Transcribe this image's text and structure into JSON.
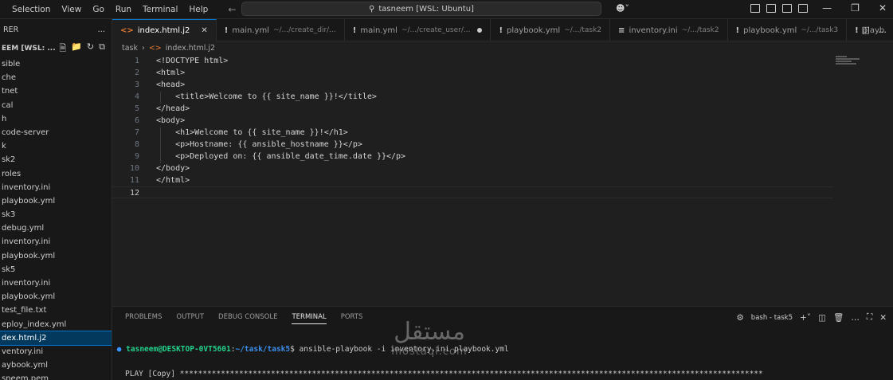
{
  "menu": [
    "Selection",
    "View",
    "Go",
    "Run",
    "Terminal",
    "Help"
  ],
  "search": {
    "label": "tasneem [WSL: Ubuntu]"
  },
  "sidebar": {
    "header": "RER",
    "folder": "EEM [WSL: ...",
    "items": [
      {
        "label": "sible",
        "selected": false
      },
      {
        "label": "che",
        "selected": false
      },
      {
        "label": "tnet",
        "selected": false
      },
      {
        "label": "cal",
        "selected": false
      },
      {
        "label": "h",
        "selected": false
      },
      {
        "label": "code-server",
        "selected": false
      },
      {
        "label": "k",
        "selected": false
      },
      {
        "label": "sk2",
        "selected": false
      },
      {
        "label": "roles",
        "selected": false
      },
      {
        "label": "inventory.ini",
        "selected": false
      },
      {
        "label": "playbook.yml",
        "selected": false
      },
      {
        "label": "sk3",
        "selected": false
      },
      {
        "label": "debug.yml",
        "selected": false
      },
      {
        "label": "inventory.ini",
        "selected": false
      },
      {
        "label": "playbook.yml",
        "selected": false
      },
      {
        "label": "sk5",
        "selected": false
      },
      {
        "label": "inventory.ini",
        "selected": false
      },
      {
        "label": "playbook.yml",
        "selected": false
      },
      {
        "label": "test_file.txt",
        "selected": false
      },
      {
        "label": "eploy_index.yml",
        "selected": false
      },
      {
        "label": "dex.html.j2",
        "selected": true
      },
      {
        "label": "ventory.ini",
        "selected": false
      },
      {
        "label": "aybook.yml",
        "selected": false
      },
      {
        "label": "sneem.pem",
        "selected": false
      }
    ]
  },
  "tabs": [
    {
      "icon": "<>",
      "name": "index.html.j2",
      "path": "",
      "active": true,
      "state": "close"
    },
    {
      "icon": "!",
      "name": "main.yml",
      "path": "~/.../create_dir/...",
      "active": false,
      "state": ""
    },
    {
      "icon": "!",
      "name": "main.yml",
      "path": "~/.../create_user/...",
      "active": false,
      "state": "dot"
    },
    {
      "icon": "!",
      "name": "playbook.yml",
      "path": "~/.../task2",
      "active": false,
      "state": ""
    },
    {
      "icon": "≡",
      "name": "inventory.ini",
      "path": "~/.../task2",
      "active": false,
      "state": ""
    },
    {
      "icon": "!",
      "name": "playbook.yml",
      "path": "~/.../task3",
      "active": false,
      "state": ""
    },
    {
      "icon": "!",
      "name": "playb",
      "path": "",
      "active": false,
      "state": ""
    }
  ],
  "breadcrumb": [
    "task",
    "index.html.j2"
  ],
  "code": [
    "<!DOCTYPE html>",
    "<html>",
    "<head>",
    "    <title>Welcome to {{ site_name }}!</title>",
    "</head>",
    "<body>",
    "    <h1>Welcome to {{ site_name }}!</h1>",
    "    <p>Hostname: {{ ansible_hostname }}</p>",
    "    <p>Deployed on: {{ ansible_date_time.date }}</p>",
    "</body>",
    "</html>",
    ""
  ],
  "panel": {
    "tabs": [
      "PROBLEMS",
      "OUTPUT",
      "DEBUG CONSOLE",
      "TERMINAL",
      "PORTS"
    ],
    "active_tab": "TERMINAL",
    "shell": "bash - task5"
  },
  "terminal": {
    "user": "tasneem@DESKTOP-0VT5601",
    "sep": ":",
    "path": "~/task/task5",
    "command": "$ ansible-playbook -i inventory.ini playbook.yml",
    "output": "PLAY [Copy] ********************************************************************************************************************************"
  },
  "watermark": {
    "arabic": "مستقل",
    "latin": "mostaql.com"
  },
  "colors": {
    "accent": "#0078d4",
    "selected_bg": "#04395e",
    "terminal_user": "#23d18b",
    "terminal_path": "#3b8eea"
  }
}
